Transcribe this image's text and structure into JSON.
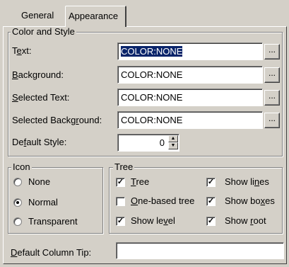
{
  "tabs": {
    "general": "General",
    "appearance": "Appearance"
  },
  "color_style": {
    "legend": "Color and Style",
    "rows": [
      {
        "label_pre": "T",
        "label_u": "e",
        "label_post": "xt:",
        "value": "COLOR:NONE",
        "selected": true
      },
      {
        "label_pre": "",
        "label_u": "B",
        "label_post": "ackground:",
        "value": "COLOR:NONE"
      },
      {
        "label_pre": "",
        "label_u": "S",
        "label_post": "elected Text:",
        "value": "COLOR:NONE"
      },
      {
        "label_pre": "Selected Backg",
        "label_u": "r",
        "label_post": "ound:",
        "value": "COLOR:NONE"
      }
    ],
    "browse_label": "...",
    "default_style": {
      "label_pre": "De",
      "label_u": "f",
      "label_post": "ault Style:",
      "value": "0"
    }
  },
  "icon": {
    "legend": "Icon",
    "options": [
      {
        "label": "None",
        "checked": false
      },
      {
        "label": "Normal",
        "checked": true
      },
      {
        "label": "Transparent",
        "checked": false
      }
    ]
  },
  "tree": {
    "legend": "Tree",
    "checkboxes": [
      {
        "pre": "",
        "u": "T",
        "post": "ree",
        "checked": true
      },
      {
        "pre": "Show li",
        "u": "n",
        "post": "es",
        "checked": true
      },
      {
        "pre": "",
        "u": "O",
        "post": "ne-based tree",
        "checked": false
      },
      {
        "pre": "Show bo",
        "u": "x",
        "post": "es",
        "checked": true
      },
      {
        "pre": "Show le",
        "u": "v",
        "post": "el",
        "checked": true
      },
      {
        "pre": "Show ",
        "u": "r",
        "post": "oot",
        "checked": true
      }
    ]
  },
  "column_tip": {
    "label_pre": "",
    "label_u": "D",
    "label_post": "efault Column Tip:",
    "value": ""
  }
}
